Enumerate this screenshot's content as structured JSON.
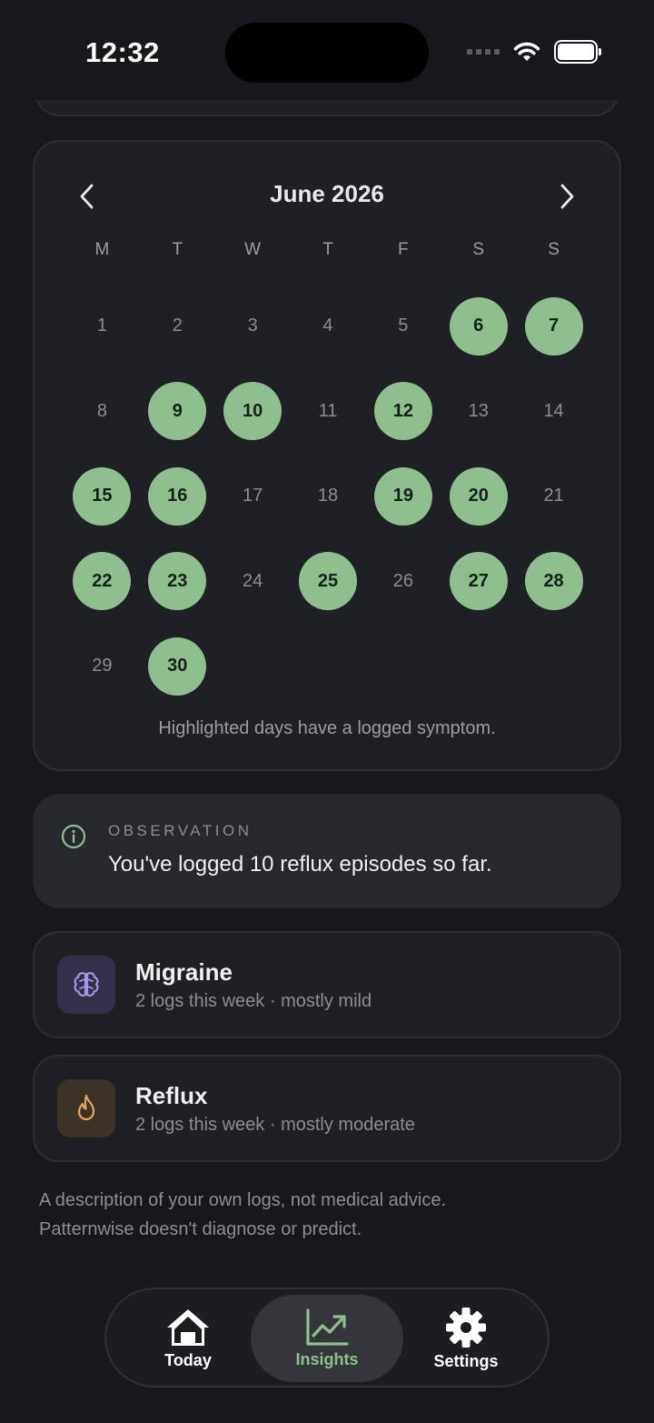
{
  "status_bar": {
    "time": "12:32"
  },
  "calendar": {
    "month_title": "June 2026",
    "weekdays": [
      "M",
      "T",
      "W",
      "T",
      "F",
      "S",
      "S"
    ],
    "first_weekday_offset": 0,
    "days_in_month": 30,
    "highlighted_days": [
      6,
      7,
      9,
      10,
      12,
      15,
      16,
      19,
      20,
      22,
      23,
      25,
      27,
      28,
      30
    ],
    "note": "Highlighted days have a logged symptom.",
    "highlight_color": "#8fbf8e"
  },
  "observation": {
    "label": "OBSERVATION",
    "text": "You've logged 10 reflux episodes so far."
  },
  "symptoms": [
    {
      "title": "Migraine",
      "subtitle": "2 logs this week · mostly mild",
      "icon": "brain-icon",
      "icon_bg": "#33304a",
      "icon_color": "#a596e8"
    },
    {
      "title": "Reflux",
      "subtitle": "2 logs this week · mostly moderate",
      "icon": "flame-icon",
      "icon_bg": "#3d3226",
      "icon_color": "#e3a85c"
    }
  ],
  "disclaimer": {
    "line1": "A description of your own logs, not medical advice.",
    "line2": "Patternwise doesn't diagnose or predict."
  },
  "tabbar": {
    "today": "Today",
    "insights": "Insights",
    "settings": "Settings",
    "active": "insights",
    "accent": "#8fbf8e"
  }
}
